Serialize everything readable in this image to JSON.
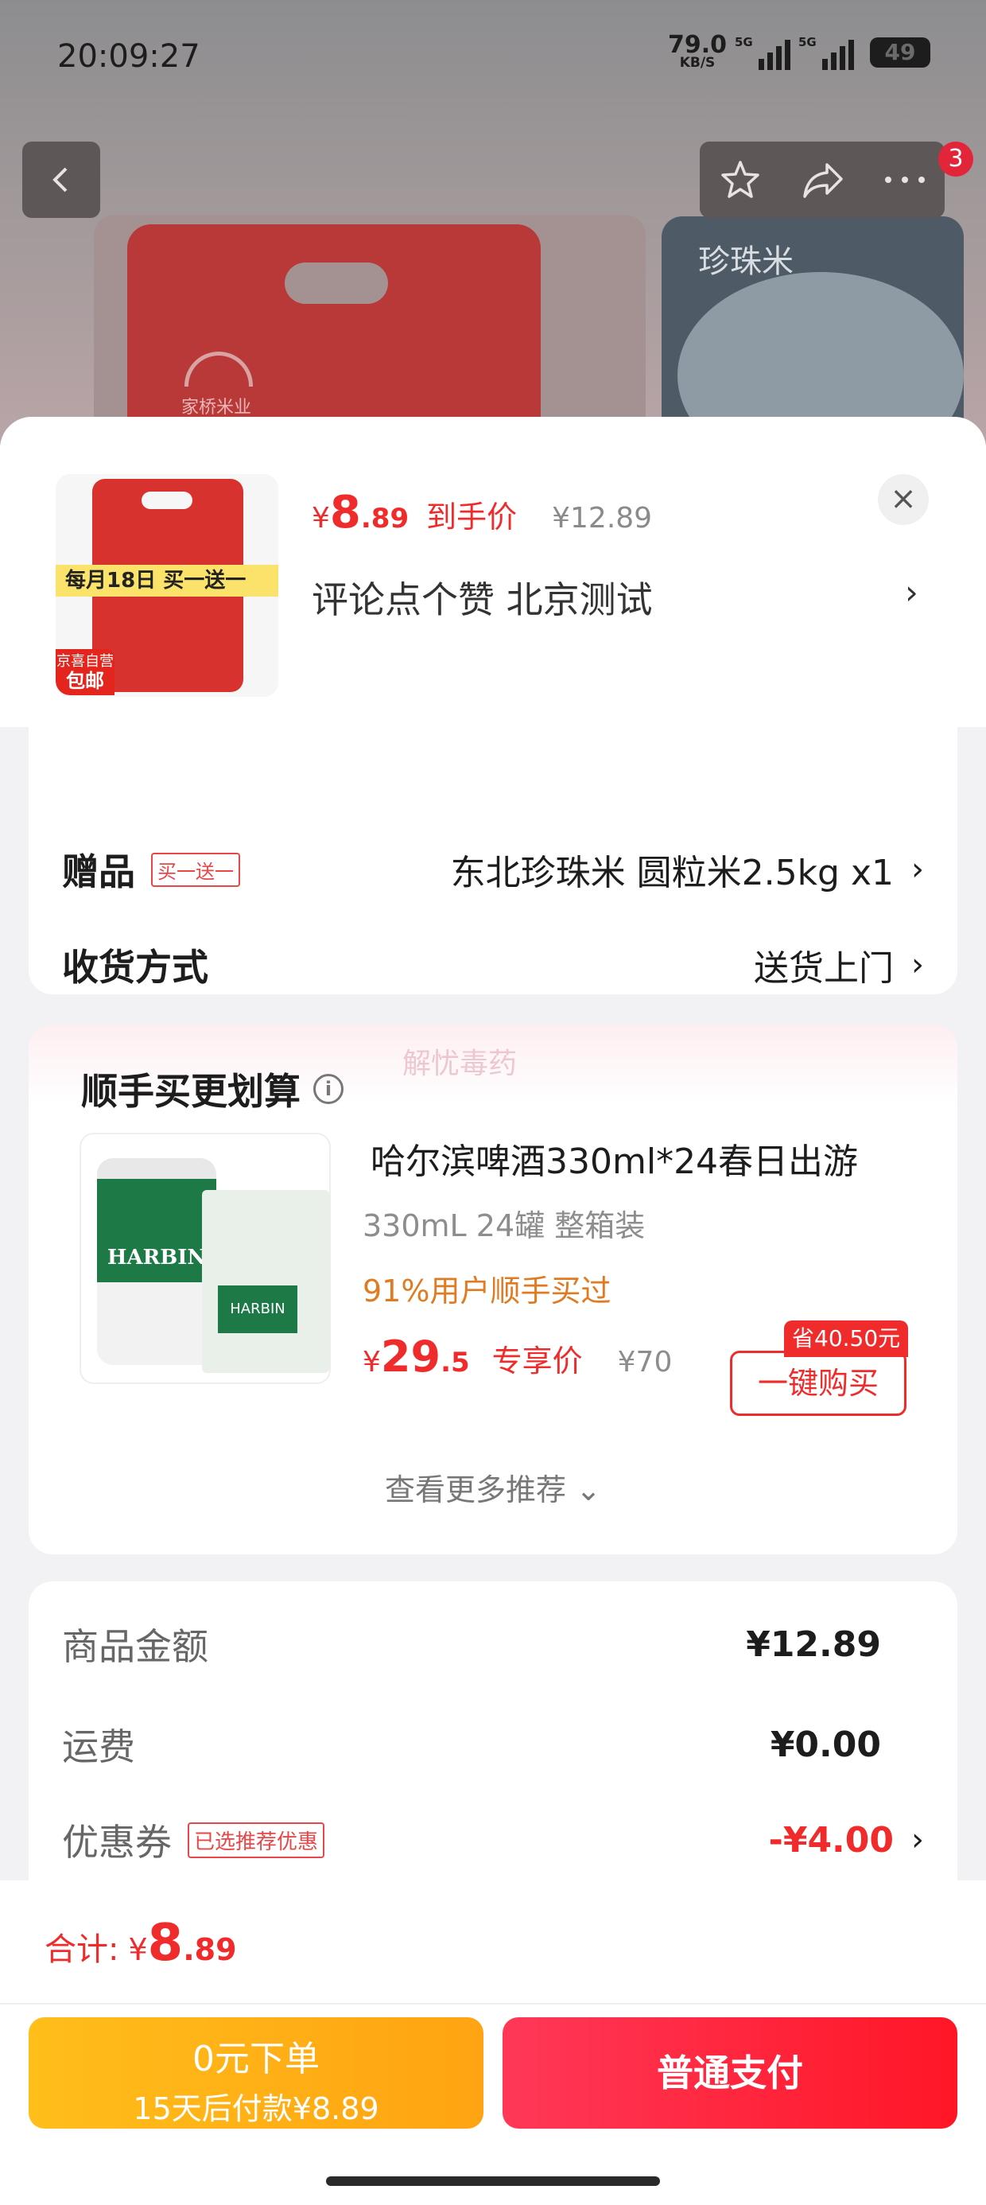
{
  "status_bar": {
    "time": "20:09:27",
    "net_speed": "79.0",
    "net_unit": "KB/S",
    "signal1": "5G",
    "signal2": "5G",
    "battery": "49"
  },
  "header": {
    "badge_count": "3",
    "icons": [
      "back-icon",
      "star-icon",
      "share-icon",
      "more-icon"
    ]
  },
  "background": {
    "brand": "家桥米业",
    "side_image_text": "珍珠米"
  },
  "product": {
    "thumb_promo": "每月18日 买一送一",
    "thumb_badge_top": "京喜自营",
    "thumb_badge_bottom": "包邮",
    "price_currency": "¥",
    "price_int": "8",
    "price_dec": ".89",
    "price_tag": "到手价",
    "original_price": "¥12.89",
    "address": "评论点个赞  北京测试"
  },
  "options": {
    "gift_label": "赠品",
    "gift_tag": "买一送一",
    "gift_value": "东北珍珠米 圆粒米2.5kg x1",
    "delivery_label": "收货方式",
    "delivery_value": "送货上门"
  },
  "recommend": {
    "title": "顺手买更划算",
    "watermark": "解忧毒药",
    "product_name": "哈尔滨啤酒330ml*24春日出游",
    "spec": "330mL 24罐 整箱装",
    "social_proof": "91%用户顺手买过",
    "price_currency": "¥",
    "price_int": "29",
    "price_dec": ".5",
    "price_tag": "专享价",
    "original_price": "¥70",
    "save_tag": "省40.50元",
    "buy_button": "一键购买",
    "more_link": "查看更多推荐 ⌄",
    "image_brand": "HARBIN"
  },
  "summary": {
    "items_label": "商品金额",
    "items_value": "¥12.89",
    "shipping_label": "运费",
    "shipping_value": "¥0.00",
    "coupon_label": "优惠券",
    "coupon_tag": "已选推荐优惠",
    "coupon_value": "-¥4.00"
  },
  "footer": {
    "total_label": "合计:",
    "total_currency": "¥",
    "total_int": "8",
    "total_dec": ".89",
    "zero_pay_title": "0元下单",
    "zero_pay_sub": "15天后付款¥8.89",
    "pay_button": "普通支付"
  },
  "colors": {
    "accent": "#ef2b2b",
    "orange": "#ffb016",
    "social": "#e07b22"
  }
}
